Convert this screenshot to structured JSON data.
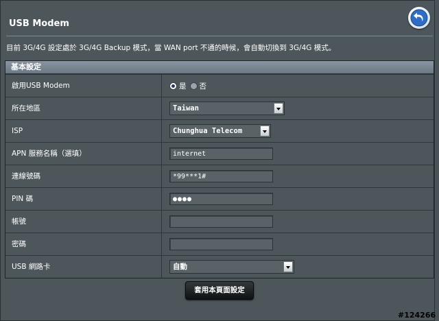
{
  "header": {
    "title": "USB Modem",
    "back_icon": "back-arrow-icon"
  },
  "description": "目前 3G/4G 設定處於 3G/4G Backup 模式，當 WAN port 不通的時候，會自動切換到 3G/4G 模式。",
  "section": {
    "title": "基本設定"
  },
  "form": {
    "enable_usb_modem": {
      "label": "啟用USB Modem",
      "options": [
        "是",
        "否"
      ],
      "selected": "是"
    },
    "location": {
      "label": "所在地區",
      "value": "Taiwan"
    },
    "isp": {
      "label": "ISP",
      "value": "Chunghua Telecom"
    },
    "apn": {
      "label": "APN 服務名稱（選填）",
      "value": "internet"
    },
    "dial_number": {
      "label": "連線號碼",
      "value": "*99***1#"
    },
    "pin": {
      "label": "PIN 碼",
      "value": "●●●●"
    },
    "username": {
      "label": "帳號",
      "value": ""
    },
    "password": {
      "label": "密碼",
      "value": ""
    },
    "usb_adapter": {
      "label": "USB 網路卡",
      "value": "自動"
    }
  },
  "apply_button": {
    "label": "套用本頁面設定"
  },
  "watermark": "#124266",
  "colors": {
    "background": "#4d575b",
    "header_bar": "#7c8894",
    "button": "#1b1f21"
  }
}
